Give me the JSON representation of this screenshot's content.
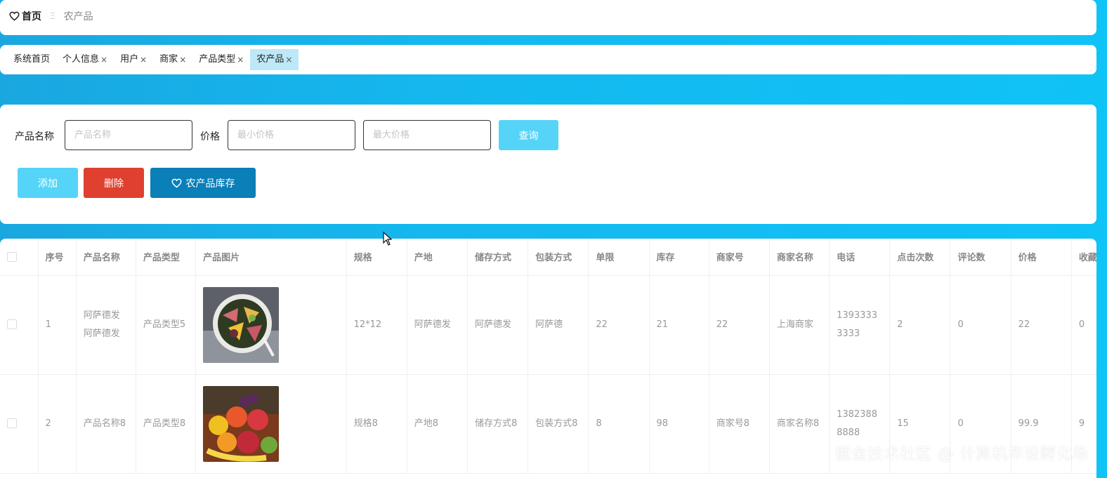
{
  "breadcrumb": {
    "home": "首页",
    "separator": "Ξ",
    "current": "农产品"
  },
  "tabs": [
    {
      "label": "系统首页",
      "closable": false
    },
    {
      "label": "个人信息",
      "closable": true
    },
    {
      "label": "用户",
      "closable": true
    },
    {
      "label": "商家",
      "closable": true
    },
    {
      "label": "产品类型",
      "closable": true
    },
    {
      "label": "农产品",
      "closable": true,
      "active": true
    }
  ],
  "close_glyph": "×",
  "search": {
    "name_label": "产品名称",
    "name_placeholder": "产品名称",
    "price_label": "价格",
    "min_placeholder": "最小价格",
    "max_placeholder": "最大价格",
    "query_label": "查询"
  },
  "actions": {
    "add_label": "添加",
    "delete_label": "删除",
    "stock_label": "农产品库存"
  },
  "colors": {
    "query": "#56d4f8",
    "add": "#56d4f8",
    "delete": "#e0402f",
    "stock": "#0a7fb8"
  },
  "table": {
    "columns": [
      "序号",
      "产品名称",
      "产品类型",
      "产品图片",
      "规格",
      "产地",
      "储存方式",
      "包装方式",
      "单限",
      "库存",
      "商家号",
      "商家名称",
      "电话",
      "点击次数",
      "评论数",
      "价格",
      "收藏"
    ],
    "rows": [
      [
        "1",
        "阿萨德发阿萨德发",
        "产品类型5",
        "",
        "12*12",
        "阿萨德发",
        "阿萨德发",
        "阿萨德",
        "22",
        "21",
        "22",
        "上海商家",
        "13933333333",
        "2",
        "0",
        "22",
        "0"
      ],
      [
        "2",
        "产品名称8",
        "产品类型8",
        "",
        "规格8",
        "产地8",
        "储存方式8",
        "包装方式8",
        "8",
        "98",
        "商家号8",
        "商家名称8",
        "13823888888",
        "15",
        "0",
        "99.9",
        "9"
      ]
    ]
  },
  "watermark": "掘金技术社区 @ 计算机毕设孵化场",
  "icons": {
    "home": "heart-icon",
    "stock": "heart-icon",
    "image1": "fruit-bowl-image",
    "image2": "fruit-pile-image"
  }
}
